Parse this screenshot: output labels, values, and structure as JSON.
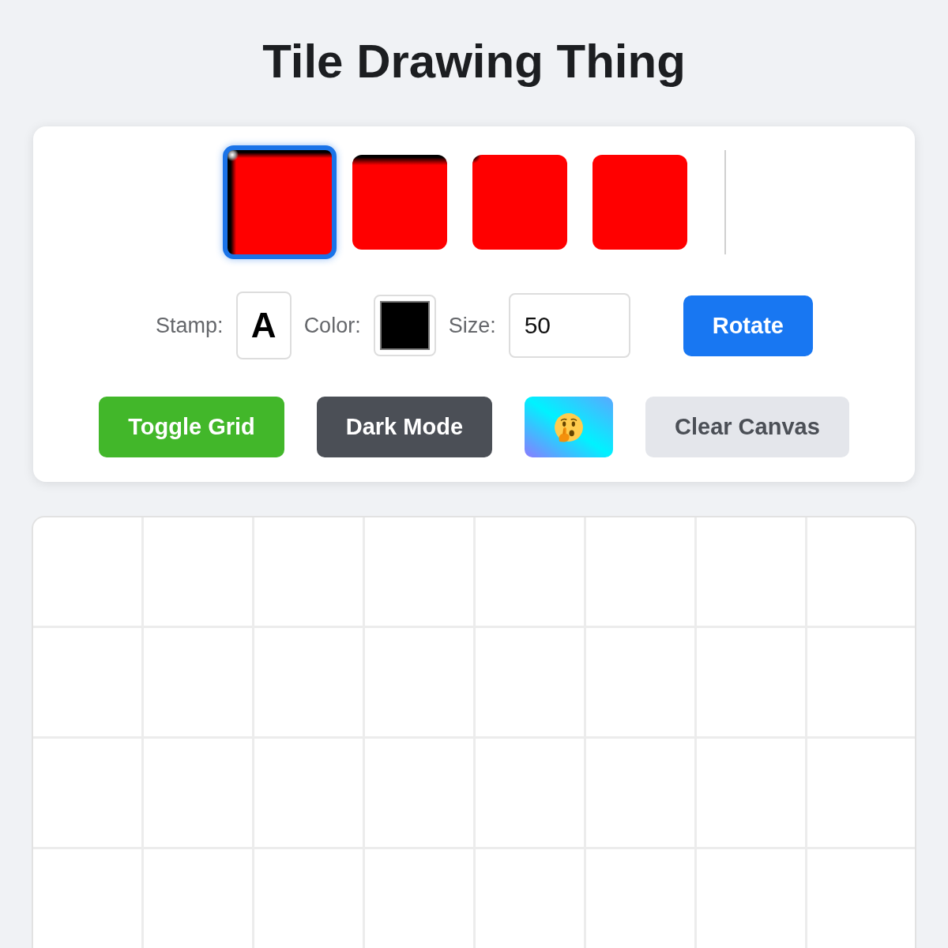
{
  "title": "Tile Drawing Thing",
  "tiles": [
    {
      "kind": "edge",
      "selected": true
    },
    {
      "kind": "top",
      "selected": false
    },
    {
      "kind": "corner",
      "selected": false
    },
    {
      "kind": "plain",
      "selected": false
    }
  ],
  "controls": {
    "stamp": {
      "label": "Stamp:",
      "value": "A"
    },
    "color": {
      "label": "Color:",
      "color": "#000000"
    },
    "size": {
      "label": "Size:",
      "value": "50"
    },
    "rotate": {
      "label": "Rotate"
    }
  },
  "buttons": [
    {
      "kind": "grid",
      "label": "Toggle Grid"
    },
    {
      "kind": "theme",
      "label": "Dark Mode"
    },
    {
      "kind": "emoji"
    },
    {
      "kind": "clear",
      "label": "Clear Canvas"
    }
  ],
  "canvas": {
    "grid_visible": true
  }
}
